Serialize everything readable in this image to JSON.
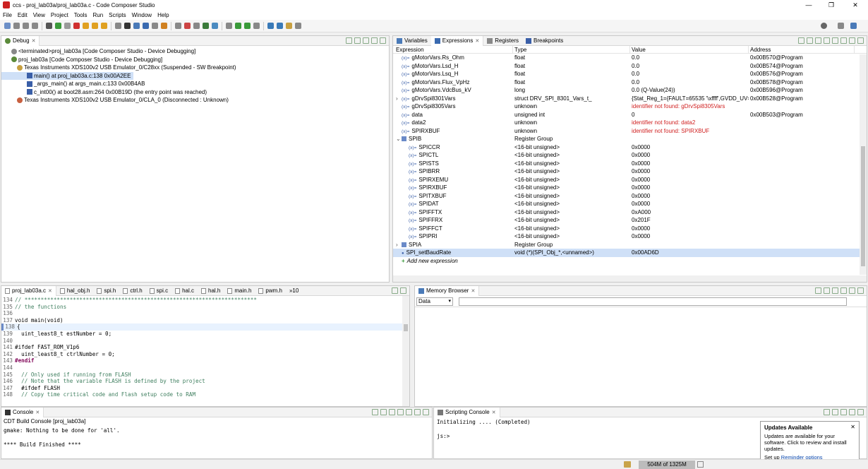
{
  "window": {
    "title": "ccs - proj_lab03a/proj_lab03a.c - Code Composer Studio",
    "min": "—",
    "max": "❐",
    "close": "✕"
  },
  "menu": [
    "File",
    "Edit",
    "View",
    "Project",
    "Tools",
    "Run",
    "Scripts",
    "Window",
    "Help"
  ],
  "debug": {
    "tab": "Debug",
    "items": [
      {
        "indent": 14,
        "text": "<terminated>proj_lab03a [Code Composer Studio - Device Debugging]",
        "icon": "terminated-icon"
      },
      {
        "indent": 14,
        "text": "proj_lab03a [Code Composer Studio - Device Debugging]",
        "icon": "debug-session-icon"
      },
      {
        "indent": 22,
        "text": "Texas Instruments XDS100v2 USB Emulator_0/C28xx (Suspended - SW Breakpoint)",
        "icon": "thread-icon"
      },
      {
        "indent": 36,
        "text": "main() at proj_lab03a.c:138 0x00A2EE",
        "icon": "stack-frame-icon",
        "selected": true
      },
      {
        "indent": 36,
        "text": "_args_main() at args_main.c:133 0x00B4AB",
        "icon": "stack-frame-icon"
      },
      {
        "indent": 36,
        "text": "c_int00() at boot28.asm:264 0x00B19D  (the entry point was reached)",
        "icon": "stack-frame-icon"
      },
      {
        "indent": 22,
        "text": "Texas Instruments XDS100v2 USB Emulator_0/CLA_0 (Disconnected : Unknown)",
        "icon": "thread-disconnected-icon"
      }
    ]
  },
  "expr_tabs": [
    "Variables",
    "Expressions",
    "Registers",
    "Breakpoints"
  ],
  "expr_columns": [
    "Expression",
    "Type",
    "Value",
    "Address"
  ],
  "expr_rows": [
    {
      "indent": 0,
      "name": "gMotorVars.Rs_Ohm",
      "type": "float",
      "value": "0.0",
      "addr": "0x00B570@Program"
    },
    {
      "indent": 0,
      "name": "gMotorVars.Lsd_H",
      "type": "float",
      "value": "0.0",
      "addr": "0x00B574@Program"
    },
    {
      "indent": 0,
      "name": "gMotorVars.Lsq_H",
      "type": "float",
      "value": "0.0",
      "addr": "0x00B576@Program"
    },
    {
      "indent": 0,
      "name": "gMotorVars.Flux_VpHz",
      "type": "float",
      "value": "0.0",
      "addr": "0x00B578@Program"
    },
    {
      "indent": 0,
      "name": "gMotorVars.VdcBus_kV",
      "type": "long",
      "value": "0.0 (Q-Value(24))",
      "addr": "0x00B596@Program"
    },
    {
      "indent": 0,
      "exp": "›",
      "name": "gDrvSpi8301Vars",
      "type": "struct DRV_SPI_8301_Vars_t_",
      "value": "{Stat_Reg_1={FAULT=65535 '\\xffff',GVDD_UV=...",
      "addr": "0x00B528@Program"
    },
    {
      "indent": 0,
      "name": "gDrvSpi8305Vars",
      "type": "unknown",
      "value": "identifier not found: gDrvSpi8305Vars",
      "err": true,
      "addr": ""
    },
    {
      "indent": 0,
      "name": "data",
      "type": "unsigned int",
      "value": "0",
      "addr": "0x00B503@Program"
    },
    {
      "indent": 0,
      "name": "data2",
      "type": "unknown",
      "value": "identifier not found: data2",
      "err": true,
      "addr": ""
    },
    {
      "indent": 0,
      "name": "SPIRXBUF",
      "type": "unknown",
      "value": "identifier not found: SPIRXBUF",
      "err": true,
      "addr": ""
    },
    {
      "indent": 0,
      "exp": "⌄",
      "name": "SPIB",
      "type": "Register Group",
      "value": "",
      "addr": "",
      "group": true
    },
    {
      "indent": 10,
      "name": "SPICCR",
      "type": "<16-bit unsigned>",
      "value": "0x0000",
      "addr": "",
      "reg": true
    },
    {
      "indent": 10,
      "name": "SPICTL",
      "type": "<16-bit unsigned>",
      "value": "0x0000",
      "addr": "",
      "reg": true
    },
    {
      "indent": 10,
      "name": "SPISTS",
      "type": "<16-bit unsigned>",
      "value": "0x0000",
      "addr": "",
      "reg": true
    },
    {
      "indent": 10,
      "name": "SPIBRR",
      "type": "<16-bit unsigned>",
      "value": "0x0000",
      "addr": "",
      "reg": true
    },
    {
      "indent": 10,
      "name": "SPIRXEMU",
      "type": "<16-bit unsigned>",
      "value": "0x0000",
      "addr": "",
      "reg": true
    },
    {
      "indent": 10,
      "name": "SPIRXBUF",
      "type": "<16-bit unsigned>",
      "value": "0x0000",
      "addr": "",
      "reg": true
    },
    {
      "indent": 10,
      "name": "SPITXBUF",
      "type": "<16-bit unsigned>",
      "value": "0x0000",
      "addr": "",
      "reg": true
    },
    {
      "indent": 10,
      "name": "SPIDAT",
      "type": "<16-bit unsigned>",
      "value": "0x0000",
      "addr": "",
      "reg": true
    },
    {
      "indent": 10,
      "name": "SPIFFTX",
      "type": "<16-bit unsigned>",
      "value": "0xA000",
      "addr": "",
      "reg": true
    },
    {
      "indent": 10,
      "name": "SPIFFRX",
      "type": "<16-bit unsigned>",
      "value": "0x201F",
      "addr": "",
      "reg": true
    },
    {
      "indent": 10,
      "name": "SPIFFCT",
      "type": "<16-bit unsigned>",
      "value": "0x0000",
      "addr": "",
      "reg": true
    },
    {
      "indent": 10,
      "name": "SPIPRI",
      "type": "<16-bit unsigned>",
      "value": "0x0000",
      "addr": "",
      "reg": true
    },
    {
      "indent": 0,
      "exp": "›",
      "name": "SPIA",
      "type": "Register Group",
      "value": "",
      "addr": "",
      "group": true
    },
    {
      "indent": 0,
      "name": "SPI_setBaudRate",
      "type": "void (*)(SPI_Obj_*,<unnamed>)",
      "value": "0x00AD6D",
      "addr": "",
      "selected": true,
      "fn": true
    },
    {
      "indent": 0,
      "name": "Add new expression",
      "type": "",
      "value": "",
      "addr": "",
      "add": true
    }
  ],
  "editor_tabs": [
    "proj_lab03a.c",
    "hal_obj.h",
    "spi.h",
    "ctrl.h",
    "spi.c",
    "hal.c",
    "hal.h",
    "main.h",
    "pwm.h",
    "»10"
  ],
  "code": [
    {
      "n": "134",
      "t": "// ************************************************************************",
      "c": "cm"
    },
    {
      "n": "135",
      "t": "// the functions",
      "c": "cm"
    },
    {
      "n": "136",
      "t": "",
      "c": ""
    },
    {
      "n": "137",
      "t": "void main(void)",
      "c": ""
    },
    {
      "n": "138",
      "t": "{",
      "c": "",
      "hl": true
    },
    {
      "n": "139",
      "t": "  uint_least8_t estNumber = 0;",
      "c": ""
    },
    {
      "n": "140",
      "t": "",
      "c": ""
    },
    {
      "n": "141",
      "t": "#ifdef FAST_ROM_V1p6",
      "c": ""
    },
    {
      "n": "142",
      "t": "  uint_least8_t ctrlNumber = 0;",
      "c": ""
    },
    {
      "n": "143",
      "t": "#endif",
      "c": "kw"
    },
    {
      "n": "144",
      "t": "",
      "c": ""
    },
    {
      "n": "145",
      "t": "  // Only used if running from FLASH",
      "c": "cm"
    },
    {
      "n": "146",
      "t": "  // Note that the variable FLASH is defined by the project",
      "c": "cm"
    },
    {
      "n": "147",
      "t": "  #ifdef FLASH",
      "c": ""
    },
    {
      "n": "148",
      "t": "  // Copy time critical code and Flash setup code to RAM",
      "c": "cm"
    }
  ],
  "memory": {
    "tab": "Memory Browser",
    "select": "Data"
  },
  "console": {
    "tab": "Console",
    "subtitle": "CDT Build Console [proj_lab03a]",
    "lines": [
      "gmake: Nothing to be done for 'all'.",
      "",
      "**** Build Finished ****"
    ]
  },
  "scripting": {
    "tab": "Scripting Console",
    "lines": [
      "Initializing .... (Completed)",
      "",
      "js:>"
    ]
  },
  "updates": {
    "title": "Updates Available",
    "body": "Updates are available for your software. Click to review and install updates.",
    "setup": "Set up",
    "link": "Reminder options"
  },
  "status": {
    "heap": "504M of 1325M"
  }
}
